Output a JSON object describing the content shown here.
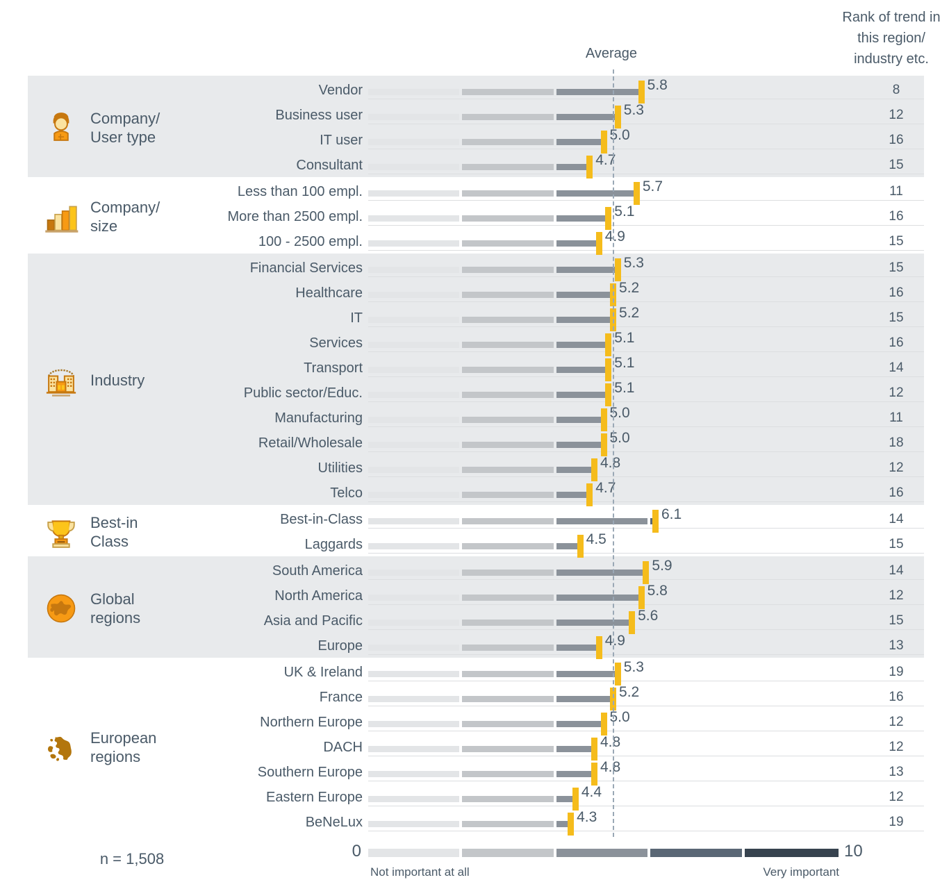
{
  "header": {
    "rank_column_title": "Rank of trend\nin this region/\nindustry etc.",
    "average_label": "Average"
  },
  "footer": {
    "scale_min": "0",
    "scale_max": "10",
    "caption_left": "Not important at all",
    "caption_right": "Very important",
    "sample_size": "n = 1,508"
  },
  "colors": {
    "marker": "#f5bc1c",
    "band": "#e8eaec",
    "text": "#4a5a68",
    "seg0": "#e3e5e7",
    "seg1": "#c3c6c9",
    "seg2": "#8b929a",
    "seg3": "#5a6775",
    "seg4": "#37434f",
    "average_line": "#9aa8b5"
  },
  "chart_data": {
    "type": "bar",
    "title": "",
    "xlabel": "",
    "ylabel": "",
    "xlim": [
      0,
      10
    ],
    "grid": false,
    "legend": "none",
    "average_value": 5.2,
    "scale_segments": [
      "0-2",
      "2-4",
      "4-6",
      "6-8",
      "8-10"
    ],
    "groups": [
      {
        "title": "Company/\nUser type",
        "icon": "person-icon",
        "shaded": true,
        "rows": [
          {
            "label": "Vendor",
            "value": 5.8,
            "value_label": "5.8",
            "rank": "8"
          },
          {
            "label": "Business user",
            "value": 5.3,
            "value_label": "5.3",
            "rank": "12"
          },
          {
            "label": "IT user",
            "value": 5.0,
            "value_label": "5.0",
            "rank": "16"
          },
          {
            "label": "Consultant",
            "value": 4.7,
            "value_label": "4.7",
            "rank": "15"
          }
        ]
      },
      {
        "title": "Company/\nsize",
        "icon": "bar-chart-icon",
        "shaded": false,
        "rows": [
          {
            "label": "Less than 100 empl.",
            "value": 5.7,
            "value_label": "5.7",
            "rank": "11"
          },
          {
            "label": "More than 2500 empl.",
            "value": 5.1,
            "value_label": "5.1",
            "rank": "16"
          },
          {
            "label": "100 - 2500 empl.",
            "value": 4.9,
            "value_label": "4.9",
            "rank": "15"
          }
        ]
      },
      {
        "title": "Industry",
        "icon": "building-icon",
        "shaded": true,
        "rows": [
          {
            "label": "Financial Services",
            "value": 5.3,
            "value_label": "5.3",
            "rank": "15"
          },
          {
            "label": "Healthcare",
            "value": 5.2,
            "value_label": "5.2",
            "rank": "16"
          },
          {
            "label": "IT",
            "value": 5.2,
            "value_label": "5.2",
            "rank": "15"
          },
          {
            "label": "Services",
            "value": 5.1,
            "value_label": "5.1",
            "rank": "16"
          },
          {
            "label": "Transport",
            "value": 5.1,
            "value_label": "5.1",
            "rank": "14"
          },
          {
            "label": "Public sector/Educ.",
            "value": 5.1,
            "value_label": "5.1",
            "rank": "12"
          },
          {
            "label": "Manufacturing",
            "value": 5.0,
            "value_label": "5.0",
            "rank": "11"
          },
          {
            "label": "Retail/Wholesale",
            "value": 5.0,
            "value_label": "5.0",
            "rank": "18"
          },
          {
            "label": "Utilities",
            "value": 4.8,
            "value_label": "4.8",
            "rank": "12"
          },
          {
            "label": "Telco",
            "value": 4.7,
            "value_label": "4.7",
            "rank": "16"
          }
        ]
      },
      {
        "title": "Best-in\nClass",
        "icon": "trophy-icon",
        "shaded": false,
        "rows": [
          {
            "label": "Best-in-Class",
            "value": 6.1,
            "value_label": "6.1",
            "rank": "14"
          },
          {
            "label": "Laggards",
            "value": 4.5,
            "value_label": "4.5",
            "rank": "15"
          }
        ]
      },
      {
        "title": "Global\nregions",
        "icon": "globe-icon",
        "shaded": true,
        "rows": [
          {
            "label": "South America",
            "value": 5.9,
            "value_label": "5.9",
            "rank": "14"
          },
          {
            "label": "North America",
            "value": 5.8,
            "value_label": "5.8",
            "rank": "12"
          },
          {
            "label": "Asia and Pacific",
            "value": 5.6,
            "value_label": "5.6",
            "rank": "15"
          },
          {
            "label": "Europe",
            "value": 4.9,
            "value_label": "4.9",
            "rank": "13"
          }
        ]
      },
      {
        "title": "European\nregions",
        "icon": "europe-map-icon",
        "shaded": false,
        "rows": [
          {
            "label": "UK & Ireland",
            "value": 5.3,
            "value_label": "5.3",
            "rank": "19"
          },
          {
            "label": "France",
            "value": 5.2,
            "value_label": "5.2",
            "rank": "16"
          },
          {
            "label": "Northern Europe",
            "value": 5.0,
            "value_label": "5.0",
            "rank": "12"
          },
          {
            "label": "DACH",
            "value": 4.8,
            "value_label": "4.8",
            "rank": "12"
          },
          {
            "label": "Southern Europe",
            "value": 4.8,
            "value_label": "4.8",
            "rank": "13"
          },
          {
            "label": "Eastern Europe",
            "value": 4.4,
            "value_label": "4.4",
            "rank": "12"
          },
          {
            "label": "BeNeLux",
            "value": 4.3,
            "value_label": "4.3",
            "rank": "19"
          }
        ]
      }
    ]
  }
}
